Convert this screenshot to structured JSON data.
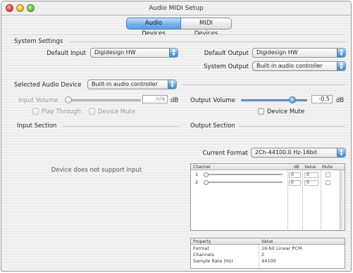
{
  "window": {
    "title": "Audio MIDI Setup"
  },
  "tabs": [
    {
      "label": "Audio Devices"
    },
    {
      "label": "MIDI Devices"
    }
  ],
  "system_settings": {
    "heading": "System Settings",
    "default_input_label": "Default Input",
    "default_input_value": "Digidesign HW",
    "default_output_label": "Default Output",
    "default_output_value": "Digidesign HW",
    "system_output_label": "System Output",
    "system_output_value": "Built-in audio controller"
  },
  "selected_device": {
    "label": "Selected Audio Device",
    "value": "Built-in audio controller"
  },
  "input_volume": {
    "label": "Input Volume",
    "value": "n/a",
    "unit": "dB",
    "play_through_label": "Play Through",
    "device_mute_label": "Device Mute"
  },
  "output_volume": {
    "label": "Output Volume",
    "value": "-0.5",
    "unit": "dB",
    "level": 0.78,
    "device_mute_label": "Device Mute"
  },
  "input_section": {
    "heading": "Input Section",
    "message": "Device does not support input"
  },
  "output_section": {
    "heading": "Output Section",
    "current_format_label": "Current Format",
    "current_format_value": "2Ch-44100.0 Hz-16bit"
  },
  "channel_table": {
    "headers": {
      "channel": "Channel",
      "db": "dB",
      "value": "Value",
      "mute": "Mute"
    },
    "rows": [
      {
        "channel": "1",
        "db": "0",
        "value": "0"
      },
      {
        "channel": "2",
        "db": "0",
        "value": "0"
      }
    ]
  },
  "property_table": {
    "headers": {
      "property": "Property",
      "value": "Value"
    },
    "rows": [
      {
        "property": "Format",
        "value": "16-bit Linear PCM"
      },
      {
        "property": "Channels",
        "value": "2"
      },
      {
        "property": "Sample Rate (Hz)",
        "value": "44100"
      }
    ]
  },
  "colors": {
    "accent": "#5a9ee3",
    "tab_active": "#73b1ee"
  }
}
